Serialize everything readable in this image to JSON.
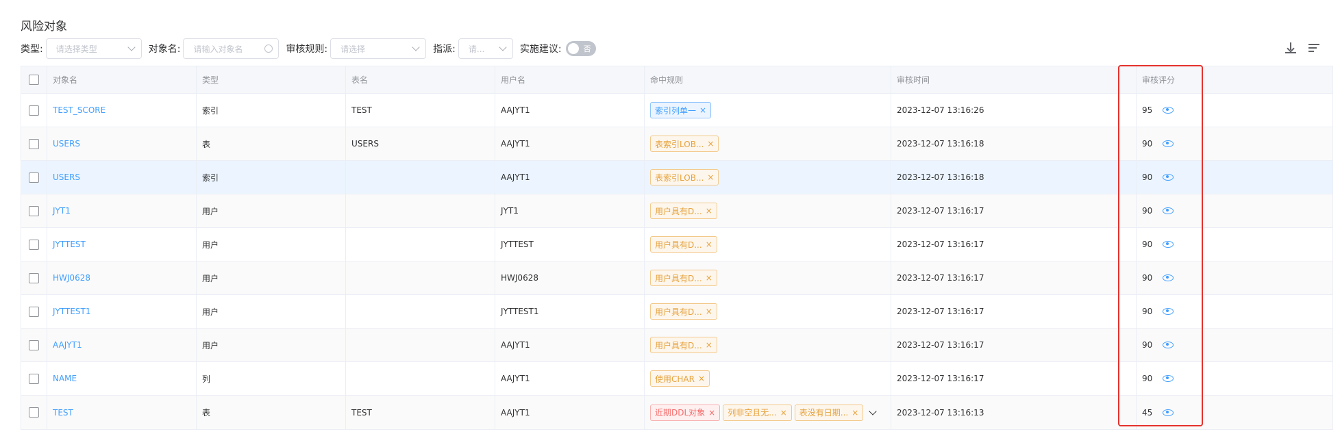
{
  "page": {
    "title": "风险对象"
  },
  "filters": {
    "type_label": "类型:",
    "type_placeholder": "请选择类型",
    "name_label": "对象名:",
    "name_placeholder": "请输入对象名",
    "rule_label": "审核规则:",
    "rule_placeholder": "请选择",
    "assign_label": "指派:",
    "assign_placeholder": "请...",
    "advice_label": "实施建议:",
    "advice_toggle": "否"
  },
  "toolbar": {
    "download_icon": "download-icon",
    "settings_icon": "column-settings-icon"
  },
  "table": {
    "headers": {
      "name": "对象名",
      "type": "类型",
      "table": "表名",
      "user": "用户名",
      "rules": "命中规则",
      "time": "审核时间",
      "score": "审核评分"
    },
    "rows": [
      {
        "name": "TEST_SCORE",
        "type": "索引",
        "table": "TEST",
        "user": "AAJYT1",
        "rules": [
          {
            "label": "索引列单一",
            "kind": "info"
          }
        ],
        "time": "2023-12-07 13:16:26",
        "score": "95"
      },
      {
        "name": "USERS",
        "type": "表",
        "table": "USERS",
        "user": "AAJYT1",
        "rules": [
          {
            "label": "表索引LOB...",
            "kind": "warn"
          }
        ],
        "time": "2023-12-07 13:16:18",
        "score": "90"
      },
      {
        "name": "USERS",
        "type": "索引",
        "table": "",
        "user": "AAJYT1",
        "rules": [
          {
            "label": "表索引LOB...",
            "kind": "warn"
          }
        ],
        "time": "2023-12-07 13:16:18",
        "score": "90"
      },
      {
        "name": "JYT1",
        "type": "用户",
        "table": "",
        "user": "JYT1",
        "rules": [
          {
            "label": "用户具有D...",
            "kind": "warn"
          }
        ],
        "time": "2023-12-07 13:16:17",
        "score": "90"
      },
      {
        "name": "JYTTEST",
        "type": "用户",
        "table": "",
        "user": "JYTTEST",
        "rules": [
          {
            "label": "用户具有D...",
            "kind": "warn"
          }
        ],
        "time": "2023-12-07 13:16:17",
        "score": "90"
      },
      {
        "name": "HWJ0628",
        "type": "用户",
        "table": "",
        "user": "HWJ0628",
        "rules": [
          {
            "label": "用户具有D...",
            "kind": "warn"
          }
        ],
        "time": "2023-12-07 13:16:17",
        "score": "90"
      },
      {
        "name": "JYTTEST1",
        "type": "用户",
        "table": "",
        "user": "JYTTEST1",
        "rules": [
          {
            "label": "用户具有D...",
            "kind": "warn"
          }
        ],
        "time": "2023-12-07 13:16:17",
        "score": "90"
      },
      {
        "name": "AAJYT1",
        "type": "用户",
        "table": "",
        "user": "AAJYT1",
        "rules": [
          {
            "label": "用户具有D...",
            "kind": "warn"
          }
        ],
        "time": "2023-12-07 13:16:17",
        "score": "90"
      },
      {
        "name": "NAME",
        "type": "列",
        "table": "",
        "user": "AAJYT1",
        "rules": [
          {
            "label": "使用CHAR",
            "kind": "warn"
          }
        ],
        "time": "2023-12-07 13:16:17",
        "score": "90"
      },
      {
        "name": "TEST",
        "type": "表",
        "table": "TEST",
        "user": "AAJYT1",
        "rules": [
          {
            "label": "近期DDL对象",
            "kind": "err"
          },
          {
            "label": "列非空且无...",
            "kind": "warn"
          },
          {
            "label": "表没有日期...",
            "kind": "warn"
          }
        ],
        "time": "2023-12-07 13:16:13",
        "score": "45"
      }
    ]
  },
  "colors": {
    "link": "#409eff",
    "highlight_box": "#e5322d",
    "tag_info": "#409eff",
    "tag_warn": "#e6a23c",
    "tag_error": "#f56c6c"
  }
}
